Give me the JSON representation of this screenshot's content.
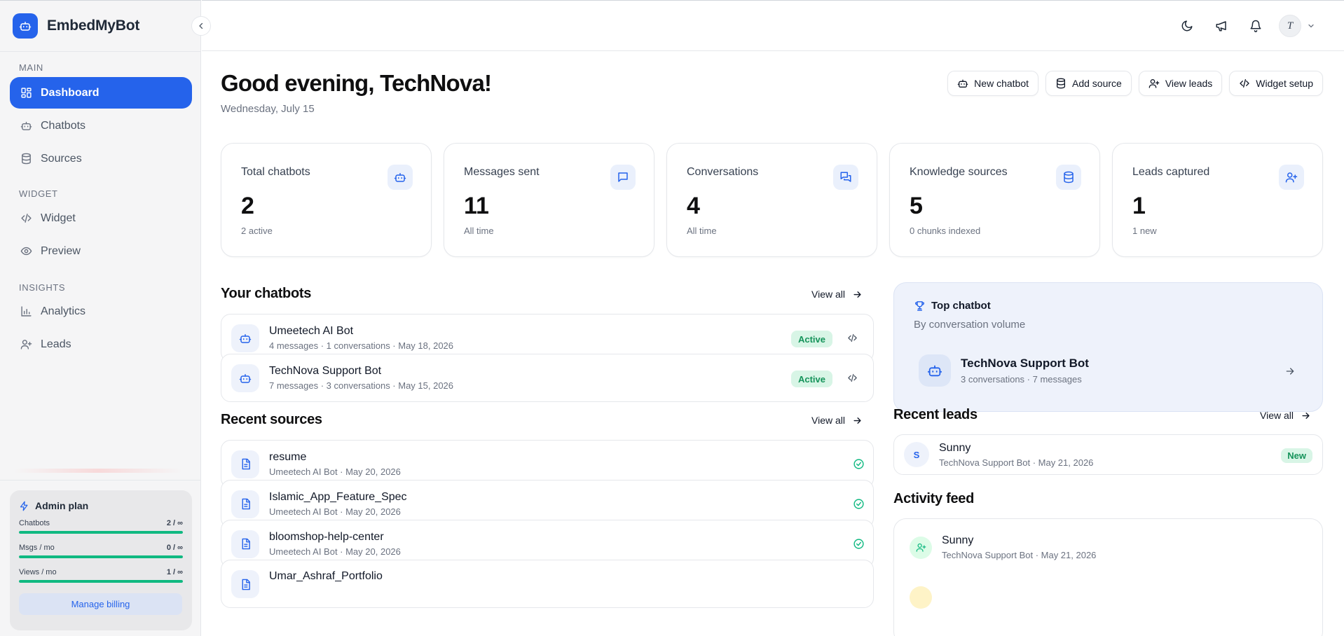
{
  "app": {
    "name": "EmbedMyBot"
  },
  "sidebar": {
    "sections": {
      "main": "MAIN",
      "widget": "WIDGET",
      "insights": "INSIGHTS"
    },
    "items": [
      {
        "label": "Dashboard",
        "icon": "dashboard-icon",
        "active": true
      },
      {
        "label": "Chatbots",
        "icon": "bot-icon",
        "active": false
      },
      {
        "label": "Sources",
        "icon": "database-icon",
        "active": false
      },
      {
        "label": "Widget",
        "icon": "code-icon",
        "active": false
      },
      {
        "label": "Preview",
        "icon": "eye-icon",
        "active": false
      },
      {
        "label": "Analytics",
        "icon": "bar-chart-icon",
        "active": false
      },
      {
        "label": "Leads",
        "icon": "user-plus-icon",
        "active": false
      }
    ],
    "plan": {
      "title": "Admin plan",
      "rows": [
        {
          "label": "Chatbots",
          "value": "2 / ∞",
          "fill": 1.0
        },
        {
          "label": "Msgs / mo",
          "value": "0 / ∞",
          "fill": 1.0
        },
        {
          "label": "Views / mo",
          "value": "1 / ∞",
          "fill": 1.0
        }
      ],
      "billing_label": "Manage billing"
    }
  },
  "topbar": {
    "icons": [
      "moon-icon",
      "megaphone-icon",
      "bell-icon"
    ],
    "avatar_initial": "T"
  },
  "header": {
    "greeting": "Good evening, TechNova!",
    "date": "Wednesday, July 15",
    "actions": [
      {
        "label": "New chatbot",
        "icon": "bot-icon"
      },
      {
        "label": "Add source",
        "icon": "database-icon"
      },
      {
        "label": "View leads",
        "icon": "user-plus-icon"
      },
      {
        "label": "Widget setup",
        "icon": "code-icon"
      }
    ]
  },
  "stats": [
    {
      "label": "Total chatbots",
      "value": "2",
      "sub": "2 active",
      "icon": "bot-icon"
    },
    {
      "label": "Messages sent",
      "value": "11",
      "sub": "All time",
      "icon": "message-icon"
    },
    {
      "label": "Conversations",
      "value": "4",
      "sub": "All time",
      "icon": "messages-icon"
    },
    {
      "label": "Knowledge sources",
      "value": "5",
      "sub": "0 chunks indexed",
      "icon": "database-icon"
    },
    {
      "label": "Leads captured",
      "value": "1",
      "sub": "1 new",
      "icon": "user-plus-icon"
    }
  ],
  "chatbots": {
    "title": "Your chatbots",
    "view_all": "View all",
    "items": [
      {
        "name": "Umeetech AI Bot",
        "meta": "4 messages · 1 conversations · May 18, 2026",
        "status": "Active"
      },
      {
        "name": "TechNova Support Bot",
        "meta": "7 messages · 3 conversations · May 15, 2026",
        "status": "Active"
      }
    ]
  },
  "sources": {
    "title": "Recent sources",
    "view_all": "View all",
    "items": [
      {
        "name": "resume",
        "meta": "Umeetech AI Bot · May 20, 2026"
      },
      {
        "name": "Islamic_App_Feature_Spec",
        "meta": "Umeetech AI Bot · May 20, 2026"
      },
      {
        "name": "bloomshop-help-center",
        "meta": "Umeetech AI Bot · May 20, 2026"
      },
      {
        "name": "Umar_Ashraf_Portfolio",
        "meta": ""
      }
    ]
  },
  "top_chatbot": {
    "title": "Top chatbot",
    "subtitle": "By conversation volume",
    "name": "TechNova Support Bot",
    "meta": "3 conversations · 7 messages"
  },
  "leads": {
    "title": "Recent leads",
    "view_all": "View all",
    "items": [
      {
        "initial": "S",
        "name": "Sunny",
        "meta": "TechNova Support Bot · May 21, 2026",
        "badge": "New"
      }
    ]
  },
  "activity": {
    "title": "Activity feed",
    "items": [
      {
        "title": "Sunny",
        "meta": "TechNova Support Bot · May 21, 2026"
      }
    ]
  },
  "colors": {
    "accent": "#2563eb",
    "success": "#10b981",
    "success_badge_bg": "#d8f5e6",
    "sidebar_bg": "#f5f5f6"
  }
}
